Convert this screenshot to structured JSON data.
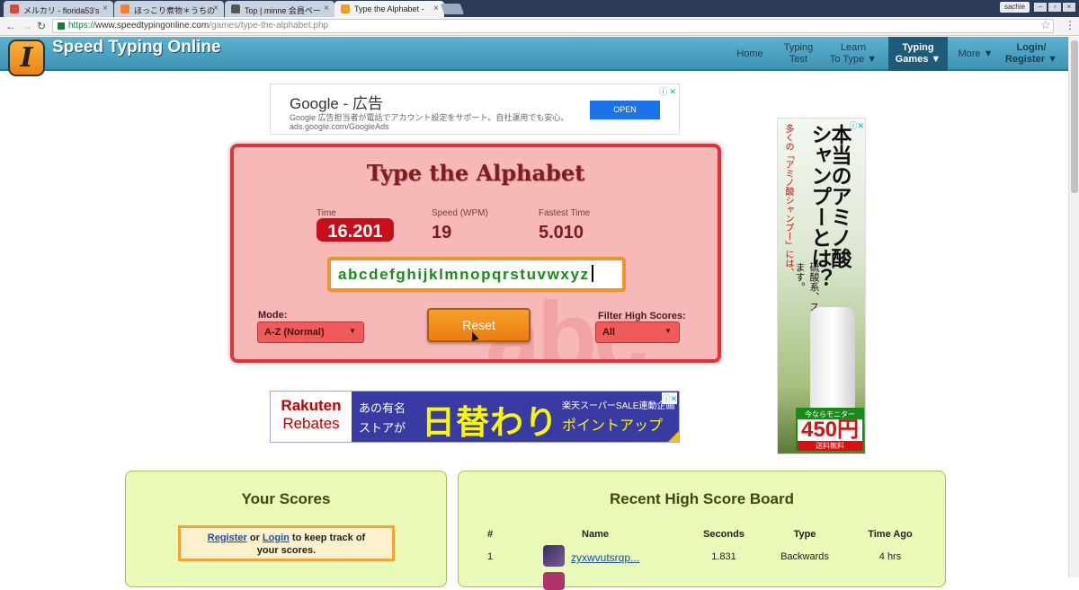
{
  "browser": {
    "tabs": [
      {
        "title": "メルカリ - florida53's",
        "icon_color": "#e0443a"
      },
      {
        "title": "ほっこり煮物＊うちの",
        "icon_color": "#f08030"
      },
      {
        "title": "Top | minne 会員ペー",
        "icon_color": "#555555"
      },
      {
        "title": "Type the Alphabet - ",
        "icon_color": "#f0a020"
      }
    ],
    "user": "sachie",
    "url_https": "https://",
    "url_host": "www.speedtypingonline.com",
    "url_path": "/games/type-the-alphabet.php"
  },
  "site": {
    "logo_letter": "I",
    "title": "Speed Typing Online",
    "nav": [
      {
        "line1": "Home",
        "line2": ""
      },
      {
        "line1": "Typing",
        "line2": "Test"
      },
      {
        "line1": "Learn",
        "line2": "To Type ▼"
      },
      {
        "line1": "Typing",
        "line2": "Games ▼"
      },
      {
        "line1": "More ▼",
        "line2": ""
      },
      {
        "line1": "Login/",
        "line2": "Register ▼"
      }
    ]
  },
  "google_ad": {
    "title": "Google - 広告",
    "text": "Google 広告担当者が電話でアカウント設定をサポート。自社運用でも安心。",
    "url": "ads.google.com/GoogleAds",
    "button": "OPEN",
    "close": "ⓘ ✕"
  },
  "game": {
    "title": "Type the Alphabet",
    "watermark": "abc",
    "time_label": "Time",
    "time_value": "16.201",
    "speed_label": "Speed (WPM)",
    "speed_value": "19",
    "fastest_label": "Fastest Time",
    "fastest_value": "5.010",
    "typed_text": "abcdefghijklmnopqrstuvwxyz",
    "mode_label": "Mode:",
    "mode_value": "A-Z (Normal)",
    "reset_label": "Reset",
    "filter_label": "Filter High Scores:",
    "filter_value": "All"
  },
  "rakuten_ad": {
    "brand1": "Rakuten",
    "brand2": "Rebates",
    "sub1": "あの有名",
    "sub2": "ストアが",
    "big": "日替わり",
    "right1": "楽天スーパーSALE連動企画",
    "right2": "ポイントアップ"
  },
  "side_ad": {
    "headline1": "本当のアミノ酸",
    "headline2": "シャンプーとは？",
    "red_text": "多くの「アミノ酸シャンプー」には、",
    "body": "硫酸系、スルホン酸系成分が含まれています。",
    "price_top": "今ならモニター",
    "price": "450円",
    "price_bottom": "送料無料"
  },
  "scores_panel": {
    "title": "Your Scores",
    "register": "Register",
    "or": "or",
    "login": "Login",
    "rest": "to keep track of",
    "rest2": "your scores."
  },
  "board": {
    "title": "Recent High Score Board",
    "headers": [
      "#",
      "Name",
      "Seconds",
      "Type",
      "Time Ago"
    ],
    "rows": [
      {
        "rank": "1",
        "name": "zyxwvutsrqp...",
        "seconds": "1.831",
        "type": "Backwards",
        "ago": "4 hrs"
      }
    ]
  }
}
